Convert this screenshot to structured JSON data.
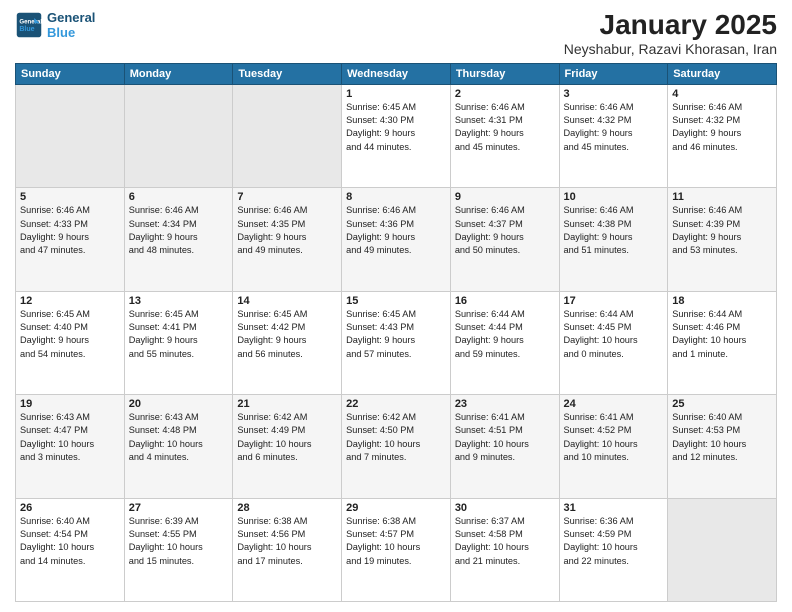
{
  "header": {
    "logo_line1": "General",
    "logo_line2": "Blue",
    "title": "January 2025",
    "subtitle": "Neyshabur, Razavi Khorasan, Iran"
  },
  "weekdays": [
    "Sunday",
    "Monday",
    "Tuesday",
    "Wednesday",
    "Thursday",
    "Friday",
    "Saturday"
  ],
  "weeks": [
    [
      {
        "day": "",
        "info": ""
      },
      {
        "day": "",
        "info": ""
      },
      {
        "day": "",
        "info": ""
      },
      {
        "day": "1",
        "info": "Sunrise: 6:45 AM\nSunset: 4:30 PM\nDaylight: 9 hours\nand 44 minutes."
      },
      {
        "day": "2",
        "info": "Sunrise: 6:46 AM\nSunset: 4:31 PM\nDaylight: 9 hours\nand 45 minutes."
      },
      {
        "day": "3",
        "info": "Sunrise: 6:46 AM\nSunset: 4:32 PM\nDaylight: 9 hours\nand 45 minutes."
      },
      {
        "day": "4",
        "info": "Sunrise: 6:46 AM\nSunset: 4:32 PM\nDaylight: 9 hours\nand 46 minutes."
      }
    ],
    [
      {
        "day": "5",
        "info": "Sunrise: 6:46 AM\nSunset: 4:33 PM\nDaylight: 9 hours\nand 47 minutes."
      },
      {
        "day": "6",
        "info": "Sunrise: 6:46 AM\nSunset: 4:34 PM\nDaylight: 9 hours\nand 48 minutes."
      },
      {
        "day": "7",
        "info": "Sunrise: 6:46 AM\nSunset: 4:35 PM\nDaylight: 9 hours\nand 49 minutes."
      },
      {
        "day": "8",
        "info": "Sunrise: 6:46 AM\nSunset: 4:36 PM\nDaylight: 9 hours\nand 49 minutes."
      },
      {
        "day": "9",
        "info": "Sunrise: 6:46 AM\nSunset: 4:37 PM\nDaylight: 9 hours\nand 50 minutes."
      },
      {
        "day": "10",
        "info": "Sunrise: 6:46 AM\nSunset: 4:38 PM\nDaylight: 9 hours\nand 51 minutes."
      },
      {
        "day": "11",
        "info": "Sunrise: 6:46 AM\nSunset: 4:39 PM\nDaylight: 9 hours\nand 53 minutes."
      }
    ],
    [
      {
        "day": "12",
        "info": "Sunrise: 6:45 AM\nSunset: 4:40 PM\nDaylight: 9 hours\nand 54 minutes."
      },
      {
        "day": "13",
        "info": "Sunrise: 6:45 AM\nSunset: 4:41 PM\nDaylight: 9 hours\nand 55 minutes."
      },
      {
        "day": "14",
        "info": "Sunrise: 6:45 AM\nSunset: 4:42 PM\nDaylight: 9 hours\nand 56 minutes."
      },
      {
        "day": "15",
        "info": "Sunrise: 6:45 AM\nSunset: 4:43 PM\nDaylight: 9 hours\nand 57 minutes."
      },
      {
        "day": "16",
        "info": "Sunrise: 6:44 AM\nSunset: 4:44 PM\nDaylight: 9 hours\nand 59 minutes."
      },
      {
        "day": "17",
        "info": "Sunrise: 6:44 AM\nSunset: 4:45 PM\nDaylight: 10 hours\nand 0 minutes."
      },
      {
        "day": "18",
        "info": "Sunrise: 6:44 AM\nSunset: 4:46 PM\nDaylight: 10 hours\nand 1 minute."
      }
    ],
    [
      {
        "day": "19",
        "info": "Sunrise: 6:43 AM\nSunset: 4:47 PM\nDaylight: 10 hours\nand 3 minutes."
      },
      {
        "day": "20",
        "info": "Sunrise: 6:43 AM\nSunset: 4:48 PM\nDaylight: 10 hours\nand 4 minutes."
      },
      {
        "day": "21",
        "info": "Sunrise: 6:42 AM\nSunset: 4:49 PM\nDaylight: 10 hours\nand 6 minutes."
      },
      {
        "day": "22",
        "info": "Sunrise: 6:42 AM\nSunset: 4:50 PM\nDaylight: 10 hours\nand 7 minutes."
      },
      {
        "day": "23",
        "info": "Sunrise: 6:41 AM\nSunset: 4:51 PM\nDaylight: 10 hours\nand 9 minutes."
      },
      {
        "day": "24",
        "info": "Sunrise: 6:41 AM\nSunset: 4:52 PM\nDaylight: 10 hours\nand 10 minutes."
      },
      {
        "day": "25",
        "info": "Sunrise: 6:40 AM\nSunset: 4:53 PM\nDaylight: 10 hours\nand 12 minutes."
      }
    ],
    [
      {
        "day": "26",
        "info": "Sunrise: 6:40 AM\nSunset: 4:54 PM\nDaylight: 10 hours\nand 14 minutes."
      },
      {
        "day": "27",
        "info": "Sunrise: 6:39 AM\nSunset: 4:55 PM\nDaylight: 10 hours\nand 15 minutes."
      },
      {
        "day": "28",
        "info": "Sunrise: 6:38 AM\nSunset: 4:56 PM\nDaylight: 10 hours\nand 17 minutes."
      },
      {
        "day": "29",
        "info": "Sunrise: 6:38 AM\nSunset: 4:57 PM\nDaylight: 10 hours\nand 19 minutes."
      },
      {
        "day": "30",
        "info": "Sunrise: 6:37 AM\nSunset: 4:58 PM\nDaylight: 10 hours\nand 21 minutes."
      },
      {
        "day": "31",
        "info": "Sunrise: 6:36 AM\nSunset: 4:59 PM\nDaylight: 10 hours\nand 22 minutes."
      },
      {
        "day": "",
        "info": ""
      }
    ]
  ]
}
